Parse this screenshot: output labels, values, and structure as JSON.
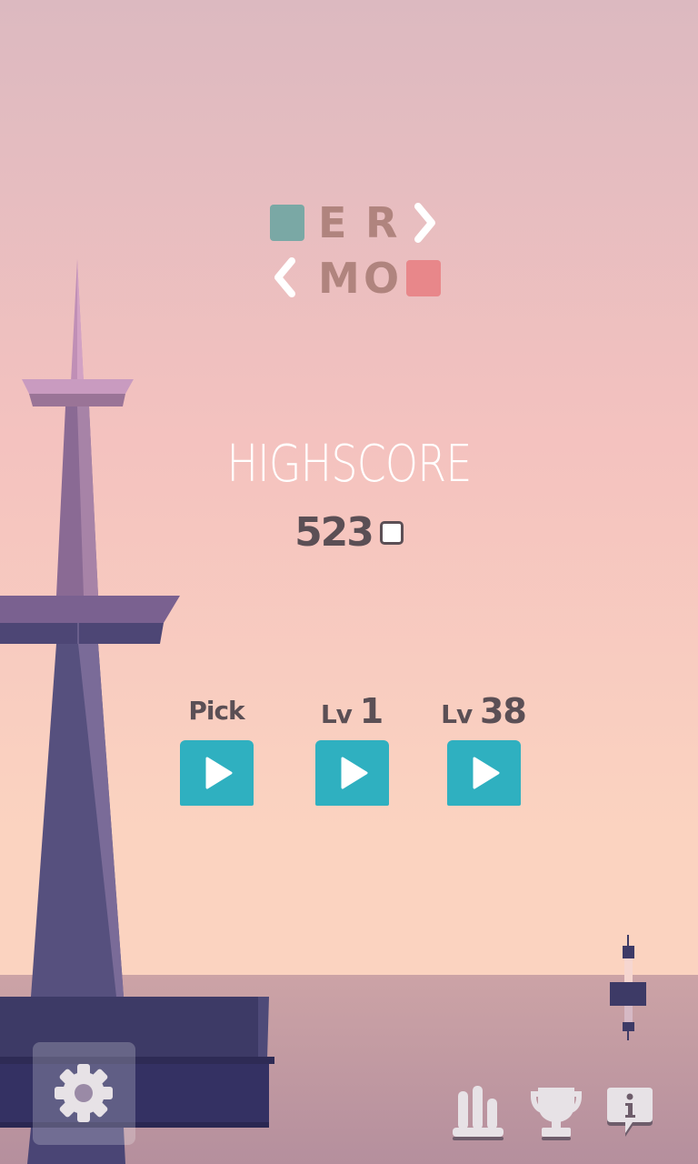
{
  "logo": {
    "row1_letters": [
      "E",
      "R"
    ],
    "row2_letters": [
      "M",
      "O"
    ],
    "square_colors": [
      "#7aa8a5",
      "#e8878a"
    ]
  },
  "highscore": {
    "label": "HIGHSCORE",
    "value": "523"
  },
  "modes": [
    {
      "prefix": "Pick",
      "number": ""
    },
    {
      "prefix": "Lv",
      "number": "1"
    },
    {
      "prefix": "Lv",
      "number": "38"
    }
  ],
  "colors": {
    "sky_top": "#dcb9c0",
    "sky_mid": "#f4c2bf",
    "sky_bottom": "#fbd3c0",
    "sea": "#c59ea3",
    "tower": "#56507e",
    "play_button": "#2fb0c0",
    "text_dark": "#5b4f55"
  },
  "icons": [
    "settings-gear-icon",
    "leaderboard-icon",
    "trophy-icon",
    "info-bubble-icon",
    "play-icon",
    "buoy-icon"
  ]
}
